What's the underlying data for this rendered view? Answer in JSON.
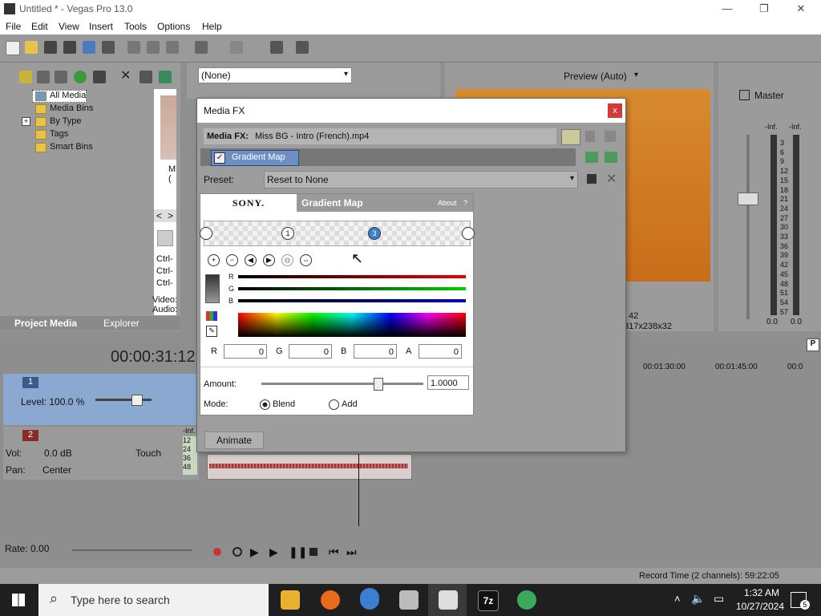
{
  "window": {
    "title": "Untitled * - Vegas Pro 13.0",
    "minimize": "—",
    "maximize": "❐",
    "close": "✕"
  },
  "menu": [
    "File",
    "Edit",
    "View",
    "Insert",
    "Tools",
    "Options",
    "Help"
  ],
  "project_media": {
    "tree": [
      "All Media",
      "Media Bins",
      "By Type",
      "Tags",
      "Smart Bins"
    ],
    "expand": "+",
    "thumb_label": "M",
    "thumb_sub": "(",
    "nav_left": "<",
    "nav_right": ">",
    "ctrl": [
      "Ctrl-",
      "Ctrl-",
      "Ctrl-"
    ],
    "video_label": "Video:",
    "audio_label": "Audio:",
    "tabs": [
      "Project Media",
      "Explorer"
    ]
  },
  "fx_select": {
    "value": "(None)"
  },
  "preview": {
    "mode": "Preview (Auto)",
    "info1": "42",
    "info2": "317x238x32"
  },
  "master": {
    "title": "Master",
    "inf_left": "-Inf.",
    "inf_right": "-Inf.",
    "scale": [
      "3",
      "6",
      "9",
      "12",
      "15",
      "18",
      "21",
      "24",
      "27",
      "30",
      "33",
      "36",
      "39",
      "42",
      "45",
      "48",
      "51",
      "54",
      "57"
    ],
    "bottom_left": "0.0",
    "bottom_right": "0.0"
  },
  "media_fx": {
    "title": "Media FX",
    "close": "x",
    "label": "Media FX:",
    "file": "Miss BG - Intro (French).mp4",
    "chain_item": "Gradient Map",
    "preset_label": "Preset:",
    "preset_value": "Reset to None",
    "sony": "SONY.",
    "plugin_title": "Gradient Map",
    "about": "About",
    "about_q": "?",
    "stops": [
      "1",
      "3"
    ],
    "rgb_labels": [
      "R",
      "G",
      "B"
    ],
    "fields": [
      {
        "label": "R",
        "value": "0"
      },
      {
        "label": "G",
        "value": "0"
      },
      {
        "label": "B",
        "value": "0"
      },
      {
        "label": "A",
        "value": "0"
      }
    ],
    "amount_label": "Amount:",
    "amount_value": "1.0000",
    "amount_fraction": 0.72,
    "mode_label": "Mode:",
    "mode_blend": "Blend",
    "mode_add": "Add",
    "animate": "Animate"
  },
  "timeline": {
    "timecode": "00:00:31:12",
    "ruler": [
      "00:01:30:00",
      "00:01:45:00",
      "00:0"
    ],
    "track1": {
      "number": "1",
      "level": "Level: 100.0 %"
    },
    "track2": {
      "number": "2",
      "vol": "Vol:",
      "vol_value": "0.0 dB",
      "pan": "Pan:",
      "pan_value": "Center",
      "touch": "Touch",
      "inf": "-Inf.",
      "meter": [
        "12",
        "24",
        "36",
        "48"
      ]
    },
    "rate": "Rate: 0.00",
    "record_time": "Record Time (2 channels): 59:22:05",
    "right_p": "P"
  },
  "taskbar": {
    "search_placeholder": "Type here to search",
    "time": "1:32 AM",
    "date": "10/27/2024",
    "notif": "5",
    "app_7z": "7z"
  },
  "colors": {
    "accent_blue": "#3a78c4",
    "close_red": "#d33a3a",
    "taskbar": "#1f1f1f"
  }
}
